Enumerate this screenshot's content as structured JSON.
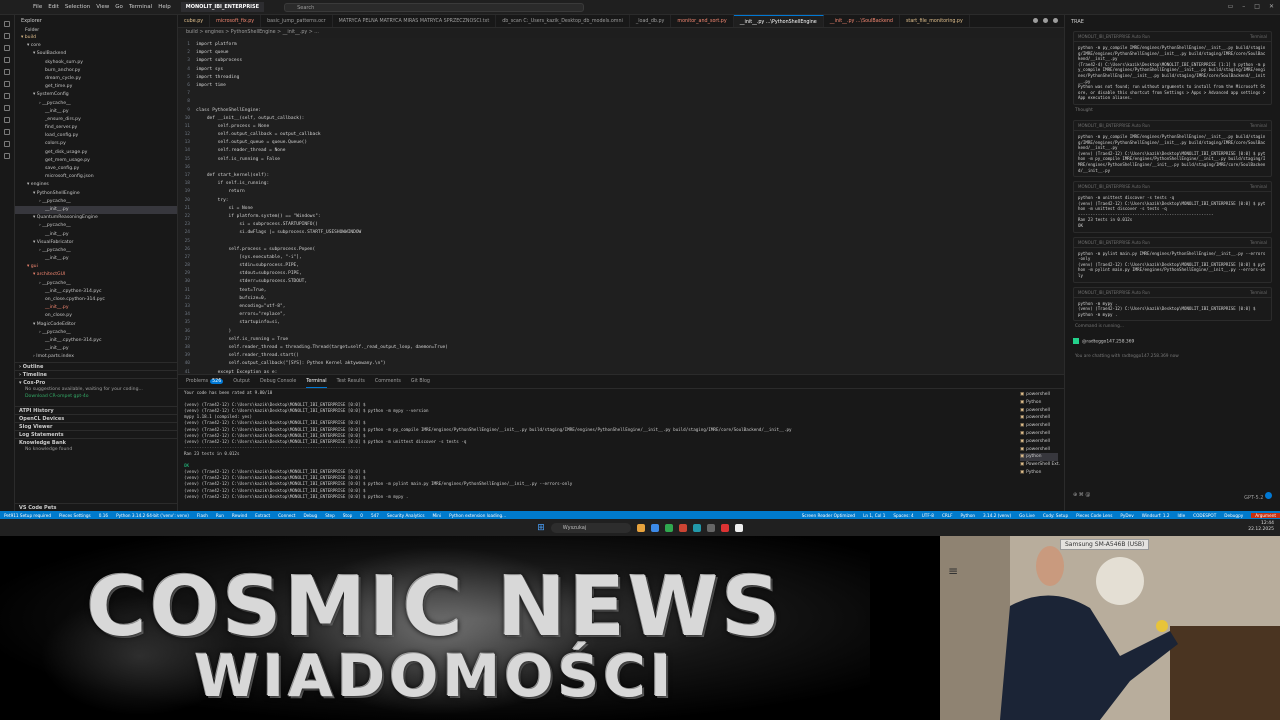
{
  "titlebar": {
    "menu": [
      "File",
      "Edit",
      "Selection",
      "View",
      "Go",
      "Terminal",
      "Help"
    ],
    "workspace_tab": "MONOLIT_IBI_ENTERPRISE",
    "search_placeholder": "Search"
  },
  "explorer": {
    "title": "Explorer",
    "folder": "Folder",
    "tree": [
      {
        "label": "▾ build",
        "indent": 1,
        "state": "git"
      },
      {
        "label": "▾ core",
        "indent": 2
      },
      {
        "label": "▾ SoulBackend",
        "indent": 3
      },
      {
        "label": "skyhook_sum.py",
        "indent": 5
      },
      {
        "label": "burn_anchor.py",
        "indent": 5
      },
      {
        "label": "dream_cycle.py",
        "indent": 5
      },
      {
        "label": "get_time.py",
        "indent": 5
      },
      {
        "label": "▾ SystemConfig",
        "indent": 3
      },
      {
        "label": "› __pycache__",
        "indent": 4
      },
      {
        "label": "__init__.py",
        "indent": 5
      },
      {
        "label": "_ensure_dirs.py",
        "indent": 5
      },
      {
        "label": "find_server.py",
        "indent": 5
      },
      {
        "label": "load_config.py",
        "indent": 5
      },
      {
        "label": "colors.py",
        "indent": 5
      },
      {
        "label": "get_disk_usage.py",
        "indent": 5
      },
      {
        "label": "get_mem_usage.py",
        "indent": 5
      },
      {
        "label": "save_config.py",
        "indent": 5
      },
      {
        "label": "microsoft_config.json",
        "indent": 5
      },
      {
        "label": "▾ engines",
        "indent": 2
      },
      {
        "label": "▾ PythonShellEngine",
        "indent": 3
      },
      {
        "label": "› __pycache__",
        "indent": 4
      },
      {
        "label": "__init__.py",
        "indent": 5,
        "state": "sel"
      },
      {
        "label": "▾ QuantumReasoningEngine",
        "indent": 3
      },
      {
        "label": "› __pycache__",
        "indent": 4
      },
      {
        "label": "__init__.py",
        "indent": 5
      },
      {
        "label": "▾ VisualFabricator",
        "indent": 3
      },
      {
        "label": "› __pycache__",
        "indent": 4
      },
      {
        "label": "__init__.py",
        "indent": 5
      },
      {
        "label": "▾ gui",
        "indent": 2,
        "state": "red"
      },
      {
        "label": "▾ architectGUI",
        "indent": 3,
        "state": "red"
      },
      {
        "label": "› __pycache__",
        "indent": 4
      },
      {
        "label": "__init__.cpython-314.pyc",
        "indent": 5
      },
      {
        "label": "on_close.cpython-314.pyc",
        "indent": 5
      },
      {
        "label": "__init__.py",
        "indent": 5,
        "state": "red"
      },
      {
        "label": "on_close.py",
        "indent": 5
      },
      {
        "label": "▾ MagicCodeEditor",
        "indent": 3
      },
      {
        "label": "› __pycache__",
        "indent": 4
      },
      {
        "label": "__init__.cpython-314.pyc",
        "indent": 5
      },
      {
        "label": "__init__.py",
        "indent": 5
      },
      {
        "label": "› lmot.parts.index",
        "indent": 3
      }
    ],
    "sections": [
      {
        "label": "› Outline"
      },
      {
        "label": "› Timeline"
      }
    ],
    "copilot": {
      "label": "▾ Cox-Pro",
      "lines": [
        "No suggestions available, waiting for your coding...",
        "Download CR-ompet gpt-4o"
      ]
    },
    "bottom_sections": [
      "ATPI History",
      "OpenCL Devices",
      "Slog Viewer",
      "Log Statements",
      "Knowledge Bank"
    ],
    "knowledge_empty": "No knowledge found",
    "vs_code_pets": "VS Code Pets"
  },
  "tabs": [
    {
      "label": "cube.py",
      "state": "mod"
    },
    {
      "label": "microsoft_fix.py",
      "state": "err"
    },
    {
      "label": "basic_jump_patterns.ocr",
      "state": ""
    },
    {
      "label": "MATRYCA PELNA MATRYCA MIRAS MATRYCA SPRZECZNOSCI.txt",
      "state": ""
    },
    {
      "label": "db_scan C:_Users_kazik_Desktop_db_models.omni",
      "state": ""
    },
    {
      "label": "_load_db.py",
      "state": ""
    },
    {
      "label": "monitor_and_sort.py",
      "state": "err"
    },
    {
      "label": "__init__.py  ...\\PythonShellEngine",
      "state": "act"
    },
    {
      "label": "__init__.py  ...\\SoulBackend",
      "state": "err"
    },
    {
      "label": "start_file_monitoring.py",
      "state": "mod"
    }
  ],
  "breadcrumb": "build > engines > PythonShellEngine > __init__.py > ...",
  "code": [
    {
      "n": "1",
      "t": "import platform"
    },
    {
      "n": "2",
      "t": "import queue"
    },
    {
      "n": "3",
      "t": "import subprocess"
    },
    {
      "n": "4",
      "t": "import sys"
    },
    {
      "n": "5",
      "t": "import threading"
    },
    {
      "n": "6",
      "t": "import time"
    },
    {
      "n": "7",
      "t": ""
    },
    {
      "n": "8",
      "t": ""
    },
    {
      "n": "9",
      "t": "class PythonShellEngine:"
    },
    {
      "n": "10",
      "t": "    def __init__(self, output_callback):"
    },
    {
      "n": "11",
      "t": "        self.process = None"
    },
    {
      "n": "12",
      "t": "        self.output_callback = output_callback"
    },
    {
      "n": "13",
      "t": "        self.output_queue = queue.Queue()"
    },
    {
      "n": "14",
      "t": "        self.reader_thread = None"
    },
    {
      "n": "15",
      "t": "        self.is_running = False"
    },
    {
      "n": "16",
      "t": ""
    },
    {
      "n": "17",
      "t": "    def start_kernel(self):"
    },
    {
      "n": "18",
      "t": "        if self.is_running:"
    },
    {
      "n": "19",
      "t": "            return"
    },
    {
      "n": "20",
      "t": "        try:"
    },
    {
      "n": "21",
      "t": "            si = None"
    },
    {
      "n": "22",
      "t": "            if platform.system() == \"Windows\":"
    },
    {
      "n": "23",
      "t": "                si = subprocess.STARTUPINFO()"
    },
    {
      "n": "24",
      "t": "                si.dwFlags |= subprocess.STARTF_USESHOWWINDOW"
    },
    {
      "n": "25",
      "t": ""
    },
    {
      "n": "26",
      "t": "            self.process = subprocess.Popen("
    },
    {
      "n": "27",
      "t": "                [sys.executable, \"-i\"],"
    },
    {
      "n": "28",
      "t": "                stdin=subprocess.PIPE,"
    },
    {
      "n": "29",
      "t": "                stdout=subprocess.PIPE,"
    },
    {
      "n": "30",
      "t": "                stderr=subprocess.STDOUT,"
    },
    {
      "n": "31",
      "t": "                text=True,"
    },
    {
      "n": "32",
      "t": "                bufsize=0,"
    },
    {
      "n": "33",
      "t": "                encoding=\"utf-8\","
    },
    {
      "n": "34",
      "t": "                errors=\"replace\","
    },
    {
      "n": "35",
      "t": "                startupinfo=si,"
    },
    {
      "n": "36",
      "t": "            )"
    },
    {
      "n": "37",
      "t": "            self.is_running = True"
    },
    {
      "n": "38",
      "t": "            self.reader_thread = threading.Thread(target=self._read_output_loop, daemon=True)"
    },
    {
      "n": "39",
      "t": "            self.reader_thread.start()"
    },
    {
      "n": "40",
      "t": "            self.output_callback(\"[SYS]: Python Kernel aktywowany.\\n\")"
    },
    {
      "n": "41",
      "t": "        except Exception as e:"
    }
  ],
  "panel": {
    "tabs": [
      "Problems",
      "Output",
      "Debug Console",
      "Terminal",
      "Test Results",
      "Comments",
      "Git Blog"
    ],
    "problems_count": "526",
    "terminal": [
      {
        "c": "",
        "t": "Your code has been rated at 9.80/10"
      },
      {
        "c": "",
        "t": ""
      },
      {
        "c": "",
        "t": "(venv) (Trae42-12) C:\\Users\\kazik\\Desktop\\MONOLIT_IBI_ENTERPRISE [0:0] $"
      },
      {
        "c": "",
        "t": "(venv) (Trae42-12) C:\\Users\\kazik\\Desktop\\MONOLIT_IBI_ENTERPRISE [0:0] $ python -m mypy --version"
      },
      {
        "c": "",
        "t": "mypy 1.18.1 (compiled: yes)"
      },
      {
        "c": "",
        "t": "(venv) (Trae42-12) C:\\Users\\kazik\\Desktop\\MONOLIT_IBI_ENTERPRISE [0:0] $"
      },
      {
        "c": "",
        "t": "(venv) (Trae42-12) C:\\Users\\kazik\\Desktop\\MONOLIT_IBI_ENTERPRISE [0:0] $ python -m py_compile IMRE/engines/PythonShellEngine/__init__.py build/staging/IMRE/engines/PythonShellEngine/__init__.py build/staging/IMRE/core/SoulBackend/__init__.py"
      },
      {
        "c": "",
        "t": "(venv) (Trae42-12) C:\\Users\\kazik\\Desktop\\MONOLIT_IBI_ENTERPRISE [0:0] $"
      },
      {
        "c": "",
        "t": "(venv) (Trae42-12) C:\\Users\\kazik\\Desktop\\MONOLIT_IBI_ENTERPRISE [0:0] $ python -m unittest discover -s tests -q"
      },
      {
        "c": "d",
        "t": "----------------------------------------------------------------------"
      },
      {
        "c": "",
        "t": "Ran 23 tests in 0.012s"
      },
      {
        "c": "",
        "t": ""
      },
      {
        "c": "g",
        "t": "OK"
      },
      {
        "c": "",
        "t": "(venv) (Trae42-12) C:\\Users\\kazik\\Desktop\\MONOLIT_IBI_ENTERPRISE [0:0] $"
      },
      {
        "c": "",
        "t": "(venv) (Trae42-12) C:\\Users\\kazik\\Desktop\\MONOLIT_IBI_ENTERPRISE [0:0] $"
      },
      {
        "c": "",
        "t": "(venv) (Trae42-12) C:\\Users\\kazik\\Desktop\\MONOLIT_IBI_ENTERPRISE [0:0] $ python -m pylint main.py IMRE/engines/PythonShellEngine/__init__.py --errors-only"
      },
      {
        "c": "",
        "t": "(venv) (Trae42-12) C:\\Users\\kazik\\Desktop\\MONOLIT_IBI_ENTERPRISE [0:0] $"
      },
      {
        "c": "",
        "t": "(venv) (Trae42-12) C:\\Users\\kazik\\Desktop\\MONOLIT_IBI_ENTERPRISE [0:0] $ python -m mypy ."
      }
    ],
    "terminals": [
      {
        "label": "powershell",
        "sel": false
      },
      {
        "label": "Python",
        "sel": false
      },
      {
        "label": "powershell",
        "sel": false
      },
      {
        "label": "powershell",
        "sel": false
      },
      {
        "label": "powershell",
        "sel": false
      },
      {
        "label": "powershell",
        "sel": false
      },
      {
        "label": "powershell",
        "sel": false
      },
      {
        "label": "powershell",
        "sel": false
      },
      {
        "label": "python",
        "sel": true
      },
      {
        "label": "PowerShell Ext.",
        "sel": false
      },
      {
        "label": "Python",
        "sel": false
      }
    ]
  },
  "chat": {
    "title": "TRAE",
    "blocks": [
      {
        "head": "MONOLIT_IBI_ENTERPRISE   Auto Run",
        "lines": [
          "python -m py_compile IMRE/engines/PythonShellEngine/__init__.py build/staging/IMRE/engines/PythonShellEngine/__init__.py build/staging/IMRE/core/SoulBackend/__init__.py",
          "",
          "(Trae42-4) C:\\Users\\kazik\\Desktop\\MONOLIT_IBI_ENTERPRISE [1:1] $ python -m py_compile IMRE/engines/PythonShellEngine/__init__.py build/staging/IMRE/engines/PythonShellEngine/__init__.py build/staging/IMRE/core/SoulBackend/__init__.py",
          "Python was not found; run without arguments to install from the Microsoft Store, or disable this shortcut from Settings > Apps > Advanced app settings > App execution aliases."
        ],
        "note": "Thought"
      },
      {
        "head": "MONOLIT_IBI_ENTERPRISE   Auto Run",
        "lines": [
          "python -m py_compile IMRE/engines/PythonShellEngine/__init__.py build/staging/IMRE/engines/PythonShellEngine/__init__.py build/staging/IMRE/core/SoulBackend/__init__.py",
          "",
          "(venv) (Trae42-12) C:\\Users\\kazik\\Desktop\\MONOLIT_IBI_ENTERPRISE [0:0] $ python -m py_compile IMRE/engines/PythonShellEngine/__init__.py build/staging/IMRE/engines/PythonShellEngine/__init__.py build/staging/IMRE/core/SoulBackend/__init__.py"
        ],
        "note": ""
      },
      {
        "head": "MONOLIT_IBI_ENTERPRISE   Auto Run",
        "lines": [
          "python -m unittest discover -s tests -q",
          "",
          "(venv) (Trae42-12) C:\\Users\\kazik\\Desktop\\MONOLIT_IBI_ENTERPRISE [0:0] $ python -m unittest discover -s tests -q",
          "-------------------------------------------------------",
          "Ran 23 tests in 0.012s",
          "",
          "OK"
        ],
        "note": ""
      },
      {
        "head": "MONOLIT_IBI_ENTERPRISE   Auto Run",
        "lines": [
          "python -m pylint main.py IMRE/engines/PythonShellEngine/__init__.py --errors-only",
          "",
          "(venv) (Trae42-12) C:\\Users\\kazik\\Desktop\\MONOLIT_IBI_ENTERPRISE [0:0] $ python -m pylint main.py IMRE/engines/PythonShellEngine/__init__.py --errors-only"
        ],
        "note": ""
      },
      {
        "head": "MONOLIT_IBI_ENTERPRISE   Auto Run",
        "lines": [
          "python -m mypy .",
          "",
          "(venv) (Trae42-12) C:\\Users\\kazik\\Desktop\\MONOLIT_IBI_ENTERPRISE [0:0] $",
          "python -m mypy ."
        ],
        "note": "Command is running..."
      }
    ],
    "bot_name": "@radteggo147.258.369",
    "bot_line": "You are chatting with radteggo147.258.369 now",
    "model": "GPT-5.2"
  },
  "statusbar": {
    "items": [
      "Pet911 Setup required",
      "Pieces Settings",
      "0.16",
      "Python 3.14.2 64-bit ('venv': venv)",
      "Flash",
      "Run",
      "Rewind",
      "Extract",
      "Connect",
      "Debug",
      "Step",
      "Stop",
      "0",
      "547",
      "Security Analytics",
      "Mini",
      "Python extension loading..."
    ],
    "right": [
      "Screen Reader Optimized",
      "Ln 1, Col 1",
      "Spaces: 4",
      "UTF-8",
      "CRLF",
      "Python",
      "3.14.2 (venv)",
      "Go Live",
      "Cody: Setup",
      "Pieces Code Lens",
      "PyDev",
      "Windsurf: 1.2",
      "Idle",
      "CODESPOT",
      "Debugpy"
    ],
    "red": "Argument"
  },
  "taskbar": {
    "search": "Wyszukaj",
    "time": "12:44",
    "date": "22.12.2025"
  },
  "banner": {
    "line1": "COSMIC NEWS",
    "line2": "WIADOMOŚCI"
  },
  "webcam": {
    "label": "Samsung SM-A546B (USB)",
    "menu_icon": "menu-icon"
  }
}
